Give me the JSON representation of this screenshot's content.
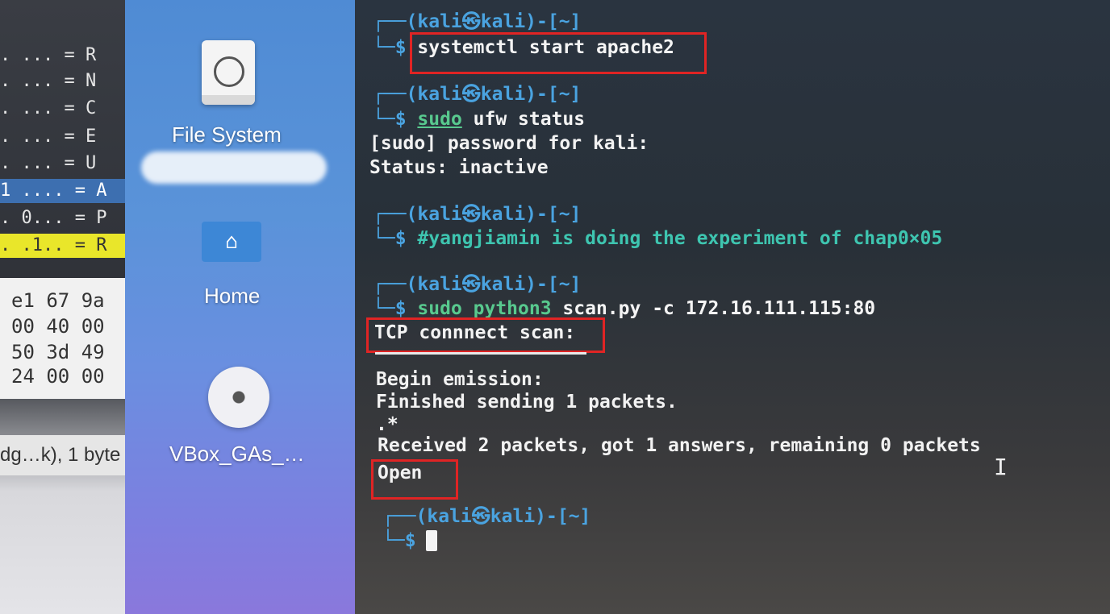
{
  "packet_pane": {
    "lines": [
      ". ... = R",
      ". ... = N",
      ". ... = C",
      ". ... = E",
      ". ... = U",
      "1 .... = A",
      ". 0... = P",
      ". .1.. = R"
    ],
    "hex": [
      "e1 67 9a",
      "00 40 00",
      "50 3d 49",
      "24 00 00"
    ],
    "status": "dg…k), 1 byte"
  },
  "desktop": {
    "icons": [
      {
        "label": "File System",
        "icon": "hard-disk-icon"
      },
      {
        "label": "Home",
        "icon": "home-folder-icon"
      },
      {
        "label": "VBox_GAs_…",
        "icon": "cd-rom-icon"
      }
    ]
  },
  "terminal": {
    "prompt_top": "┌──(kali㉿kali)-[~]",
    "prompt_user": "(kali㉿kali)-[~]",
    "prompt_sym": "└─$",
    "cmd1": "systemctl start apache2",
    "cmd2_a": "sudo",
    "cmd2_b": " ufw status",
    "out2_1": "[sudo] password for kali:",
    "out2_2": "Status: inactive",
    "cmd3": "#yangjiamin is doing the experiment of chap0×05",
    "cmd4_a": "sudo python3 ",
    "cmd4_b": "scan.py",
    "cmd4_c": " -c 172.16.111.115:80",
    "out4_1": "TCP connnect scan:",
    "out4_2": "Begin emission:",
    "out4_3": "Finished sending 1 packets.",
    "out4_4": ".*",
    "out4_5": "Received 2 packets, got 1 answers, remaining 0 packets",
    "out4_6": "Open"
  },
  "colors": {
    "prompt": "#4aa3e0",
    "comment": "#3ec5b0",
    "highlight_box": "#e02424"
  }
}
